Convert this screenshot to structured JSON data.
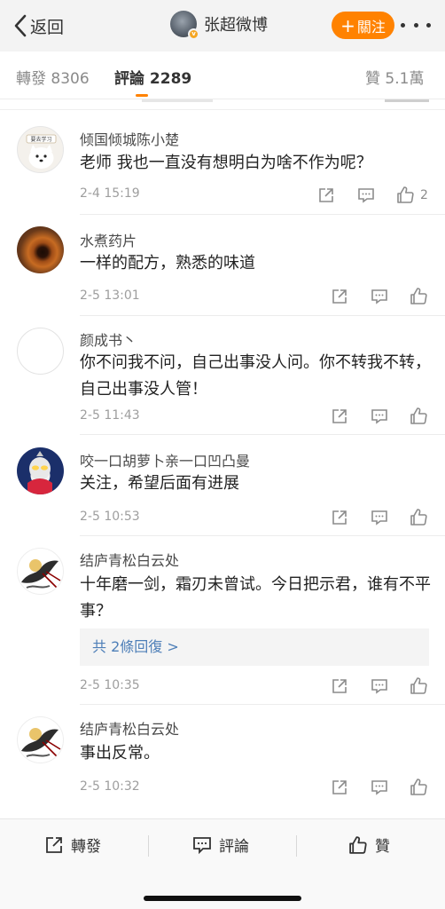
{
  "topbar": {
    "back_label": "返回",
    "title": "张超微博",
    "follow_label": "關注",
    "icons": {
      "back": "chevron-left-icon",
      "more": "more-dots-icon",
      "verified": "verified-badge-icon"
    }
  },
  "tabs": [
    {
      "label": "轉發 8306",
      "active": false
    },
    {
      "label": "評論 2289",
      "active": true
    },
    {
      "label": "贊 5.1萬",
      "active": false
    }
  ],
  "comments": [
    {
      "name": "倾国倾城陈小楚",
      "text": "老师 我也一直没有想明白为啥不作为呢？",
      "time": "2-4 15:19",
      "likes": "2",
      "avatar_text": "要去学习",
      "replies": ""
    },
    {
      "name": "水煮药片",
      "text": "一样的配方，熟悉的味道",
      "time": "2-5 13:01",
      "likes": "",
      "replies": ""
    },
    {
      "name": "颜成书丶",
      "text": "你不问我不问，自己出事没人问。你不转我不转，自己出事没人管！",
      "time": "2-5 11:43",
      "likes": "",
      "replies": ""
    },
    {
      "name": "咬一口胡萝卜亲一口凹凸曼",
      "text": "关注，希望后面有进展",
      "time": "2-5 10:53",
      "likes": "",
      "replies": ""
    },
    {
      "name": "结庐青松白云处",
      "text": "十年磨一剑，霜刃未曾试。今日把示君，谁有不平事？",
      "time": "2-5 10:35",
      "likes": "",
      "replies": "共 2條回復 >"
    },
    {
      "name": "结庐青松白云处",
      "text": "事出反常。",
      "time": "2-5 10:32",
      "likes": "",
      "replies": ""
    }
  ],
  "bottombar": {
    "repost_label": "轉發",
    "comment_label": "評論",
    "like_label": "贊"
  },
  "colors": {
    "accent": "#ff8200",
    "link": "#4e7fb8"
  }
}
